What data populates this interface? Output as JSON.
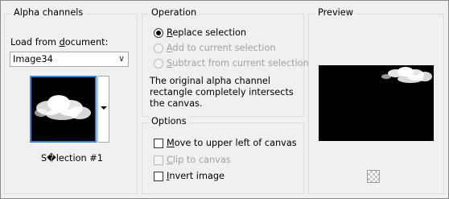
{
  "alpha_channels": {
    "title": "Alpha channels",
    "load_label": "Load from document:",
    "document_value": "Image34",
    "selection_name": "S�lection #1"
  },
  "operation": {
    "title": "Operation",
    "options": [
      {
        "label": "Replace selection",
        "selected": true,
        "enabled": true
      },
      {
        "label": "Add to current selection",
        "selected": false,
        "enabled": false
      },
      {
        "label": "Subtract from current selection",
        "selected": false,
        "enabled": false
      }
    ],
    "info": "The original alpha channel rectangle completely intersects the canvas."
  },
  "options": {
    "title": "Options",
    "checkboxes": [
      {
        "label": "Move to upper left of canvas",
        "checked": false,
        "enabled": true
      },
      {
        "label": "Clip to canvas",
        "checked": false,
        "enabled": false
      },
      {
        "label": "Invert image",
        "checked": false,
        "enabled": true
      }
    ]
  },
  "preview": {
    "title": "Preview"
  },
  "colors": {
    "selection_border": "#3b83d8",
    "canvas": "#000000",
    "cloud": "#ffffff"
  }
}
